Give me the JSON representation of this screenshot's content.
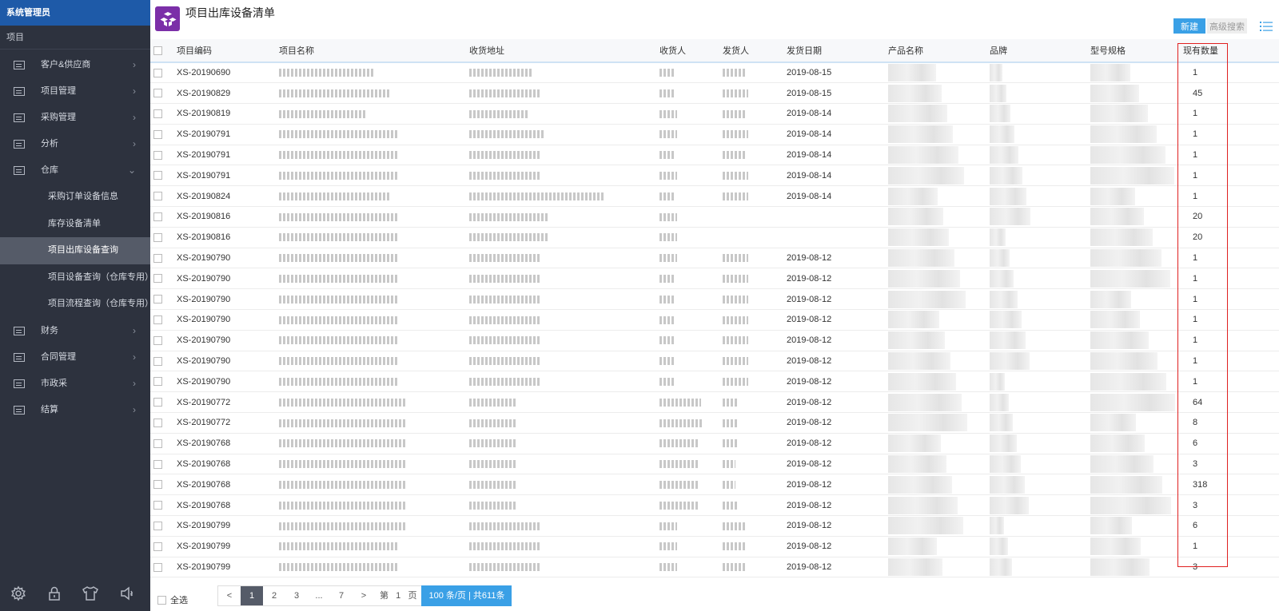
{
  "sidebar": {
    "user": "系统管理员",
    "section": "项目",
    "menu": [
      {
        "label": "客户&供应商",
        "chevron": "›"
      },
      {
        "label": "项目管理",
        "chevron": "›"
      },
      {
        "label": "采购管理",
        "chevron": "›"
      },
      {
        "label": "分析",
        "chevron": "›"
      },
      {
        "label": "仓库",
        "chevron": "⌄"
      }
    ],
    "warehouse_sub": [
      "采购订单设备信息",
      "库存设备清单",
      "项目出库设备查询",
      "项目设备查询（仓库专用）",
      "项目流程查询（仓库专用）"
    ],
    "menu_after": [
      {
        "label": "财务",
        "chevron": "›"
      },
      {
        "label": "合同管理",
        "chevron": "›"
      },
      {
        "label": "市政采",
        "chevron": "›"
      },
      {
        "label": "结算",
        "chevron": "›"
      }
    ],
    "bottom_collapse": "‹"
  },
  "header": {
    "title": "项目出库设备清单",
    "new_button": "新建",
    "advanced_search": "高级搜索"
  },
  "table": {
    "columns": [
      "项目编码",
      "项目名称",
      "收货地址",
      "收货人",
      "发货人",
      "发货日期",
      "产品名称",
      "品牌",
      "型号规格",
      "现有数量"
    ],
    "rows": [
      {
        "code": "XS-20190690",
        "date": "2019-08-15",
        "qty": "1"
      },
      {
        "code": "XS-20190829",
        "date": "2019-08-15",
        "qty": "45"
      },
      {
        "code": "XS-20190819",
        "date": "2019-08-14",
        "qty": "1"
      },
      {
        "code": "XS-20190791",
        "date": "2019-08-14",
        "qty": "1"
      },
      {
        "code": "XS-20190791",
        "date": "2019-08-14",
        "qty": "1"
      },
      {
        "code": "XS-20190791",
        "date": "2019-08-14",
        "qty": "1"
      },
      {
        "code": "XS-20190824",
        "date": "2019-08-14",
        "qty": "1"
      },
      {
        "code": "XS-20190816",
        "date": "",
        "qty": "20"
      },
      {
        "code": "XS-20190816",
        "date": "",
        "qty": "20"
      },
      {
        "code": "XS-20190790",
        "date": "2019-08-12",
        "qty": "1"
      },
      {
        "code": "XS-20190790",
        "date": "2019-08-12",
        "qty": "1"
      },
      {
        "code": "XS-20190790",
        "date": "2019-08-12",
        "qty": "1"
      },
      {
        "code": "XS-20190790",
        "date": "2019-08-12",
        "qty": "1"
      },
      {
        "code": "XS-20190790",
        "date": "2019-08-12",
        "qty": "1"
      },
      {
        "code": "XS-20190790",
        "date": "2019-08-12",
        "qty": "1"
      },
      {
        "code": "XS-20190790",
        "date": "2019-08-12",
        "qty": "1"
      },
      {
        "code": "XS-20190772",
        "date": "2019-08-12",
        "qty": "64"
      },
      {
        "code": "XS-20190772",
        "date": "2019-08-12",
        "qty": "8"
      },
      {
        "code": "XS-20190768",
        "date": "2019-08-12",
        "qty": "6"
      },
      {
        "code": "XS-20190768",
        "date": "2019-08-12",
        "qty": "3"
      },
      {
        "code": "XS-20190768",
        "date": "2019-08-12",
        "qty": "318"
      },
      {
        "code": "XS-20190768",
        "date": "2019-08-12",
        "qty": "3"
      },
      {
        "code": "XS-20190799",
        "date": "2019-08-12",
        "qty": "6"
      },
      {
        "code": "XS-20190799",
        "date": "2019-08-12",
        "qty": "1"
      },
      {
        "code": "XS-20190799",
        "date": "2019-08-12",
        "qty": "3"
      }
    ]
  },
  "footer": {
    "select_all": "全选",
    "prev": "<",
    "next": ">",
    "pages": [
      "1",
      "2",
      "3",
      "...",
      "7"
    ],
    "current_page": "1",
    "goto_prefix": "第",
    "goto_value": "1",
    "goto_suffix": "页",
    "summary": "100 条/页 | 共611条"
  },
  "colors": {
    "sidebar_bg": "#2d323e",
    "sidebar_top": "#1e5aa8",
    "accent": "#3aa0e6",
    "logo": "#7b2fa8",
    "highlight": "#e02020"
  }
}
